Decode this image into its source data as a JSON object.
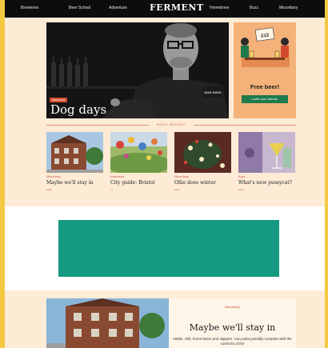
{
  "nav": {
    "logo": "FERMENT",
    "left_links": [
      "Breweries",
      "Beer School",
      "Adventure"
    ],
    "right_links": [
      "Homebrew",
      "Buzz",
      "Miscellany"
    ]
  },
  "hero": {
    "badge": "Miscellany",
    "title": "Dog days",
    "shirt_text": "DOG DAYS"
  },
  "ad": {
    "price_tag": "£12",
    "headline": "Free beer!",
    "cta": "Invite your friends"
  },
  "most_recent": {
    "label": "MOST RECENT"
  },
  "cards": [
    {
      "category": "Miscellany",
      "title": "Maybe we'll stay in",
      "more": "•••"
    },
    {
      "category": "Adventure",
      "title": "City guide: Bristol",
      "more": "–"
    },
    {
      "category": "Miscellany",
      "title": "Ollie does winter",
      "more": "•••"
    },
    {
      "category": "Buzz",
      "title": "What's new pussycat?",
      "more": "•••"
    }
  ],
  "banner": {
    "color": "#139a80"
  },
  "feature": {
    "category": "Miscellany",
    "title": "Maybe we'll stay in",
    "excerpt": "Nettle, chill, home beers and slippers. Can pubs possibly compete with the comforts of the"
  },
  "colors": {
    "accent": "#c75a3d",
    "nav_bg": "#0d0d0d",
    "page_bg": "#fdebd6",
    "cta_green": "#1f7a4c"
  }
}
